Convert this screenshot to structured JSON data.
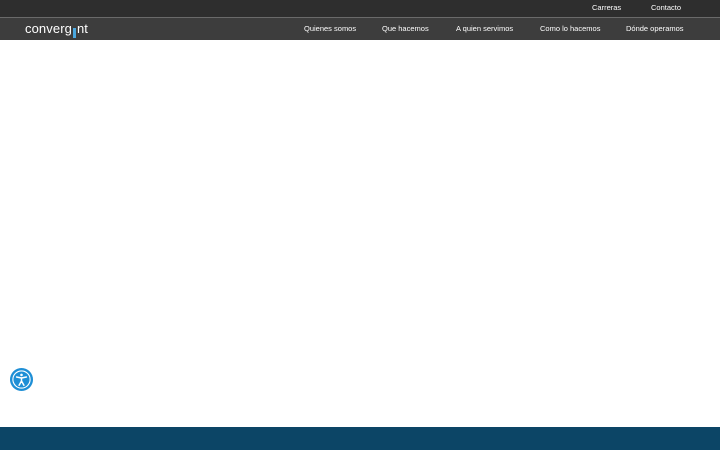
{
  "utility_nav": {
    "items": [
      {
        "label": "Carreras"
      },
      {
        "label": "Contacto"
      }
    ]
  },
  "logo": {
    "part1": "converg",
    "part2": "nt"
  },
  "main_nav": {
    "items": [
      {
        "label": "Quienes somos"
      },
      {
        "label": "Que hacemos"
      },
      {
        "label": "A quien servimos"
      },
      {
        "label": "Como lo hacemos"
      },
      {
        "label": "Dónde operamos"
      }
    ]
  },
  "accessibility": {
    "icon": "accessibility-person-icon"
  },
  "colors": {
    "accent": "#1e8fd6",
    "logo_mark": "#4aa8e0",
    "footer": "#0c4566"
  }
}
